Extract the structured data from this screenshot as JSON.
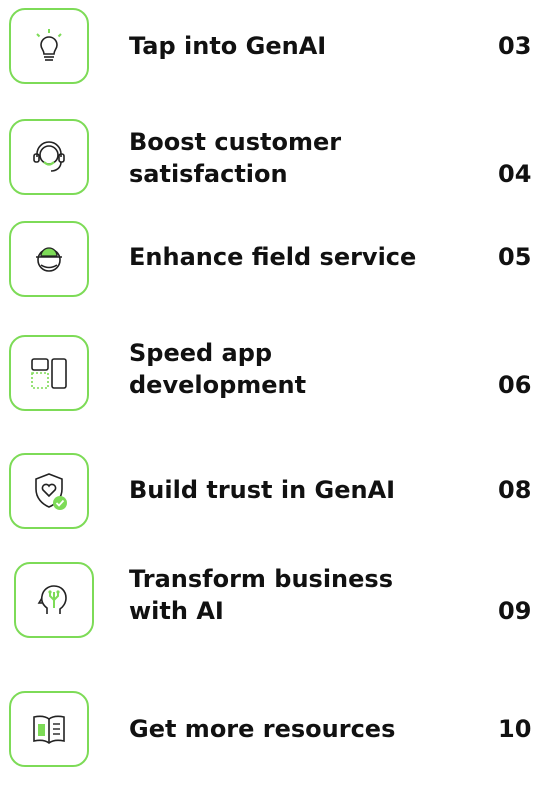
{
  "accent_color": "#7ddb57",
  "items": [
    {
      "label": "Tap into GenAI",
      "page": "03",
      "icon": "lightbulb-icon"
    },
    {
      "label": "Boost customer satisfaction",
      "page": "04",
      "icon": "headset-agent-icon"
    },
    {
      "label": "Enhance field service",
      "page": "05",
      "icon": "hard-hat-worker-icon"
    },
    {
      "label": "Speed app development",
      "page": "06",
      "icon": "app-layout-icon"
    },
    {
      "label": "Build trust in GenAI",
      "page": "08",
      "icon": "shield-heart-check-icon"
    },
    {
      "label": "Transform business with AI",
      "page": "09",
      "icon": "ai-head-icon"
    },
    {
      "label": "Get more resources",
      "page": "10",
      "icon": "open-book-icon"
    }
  ]
}
